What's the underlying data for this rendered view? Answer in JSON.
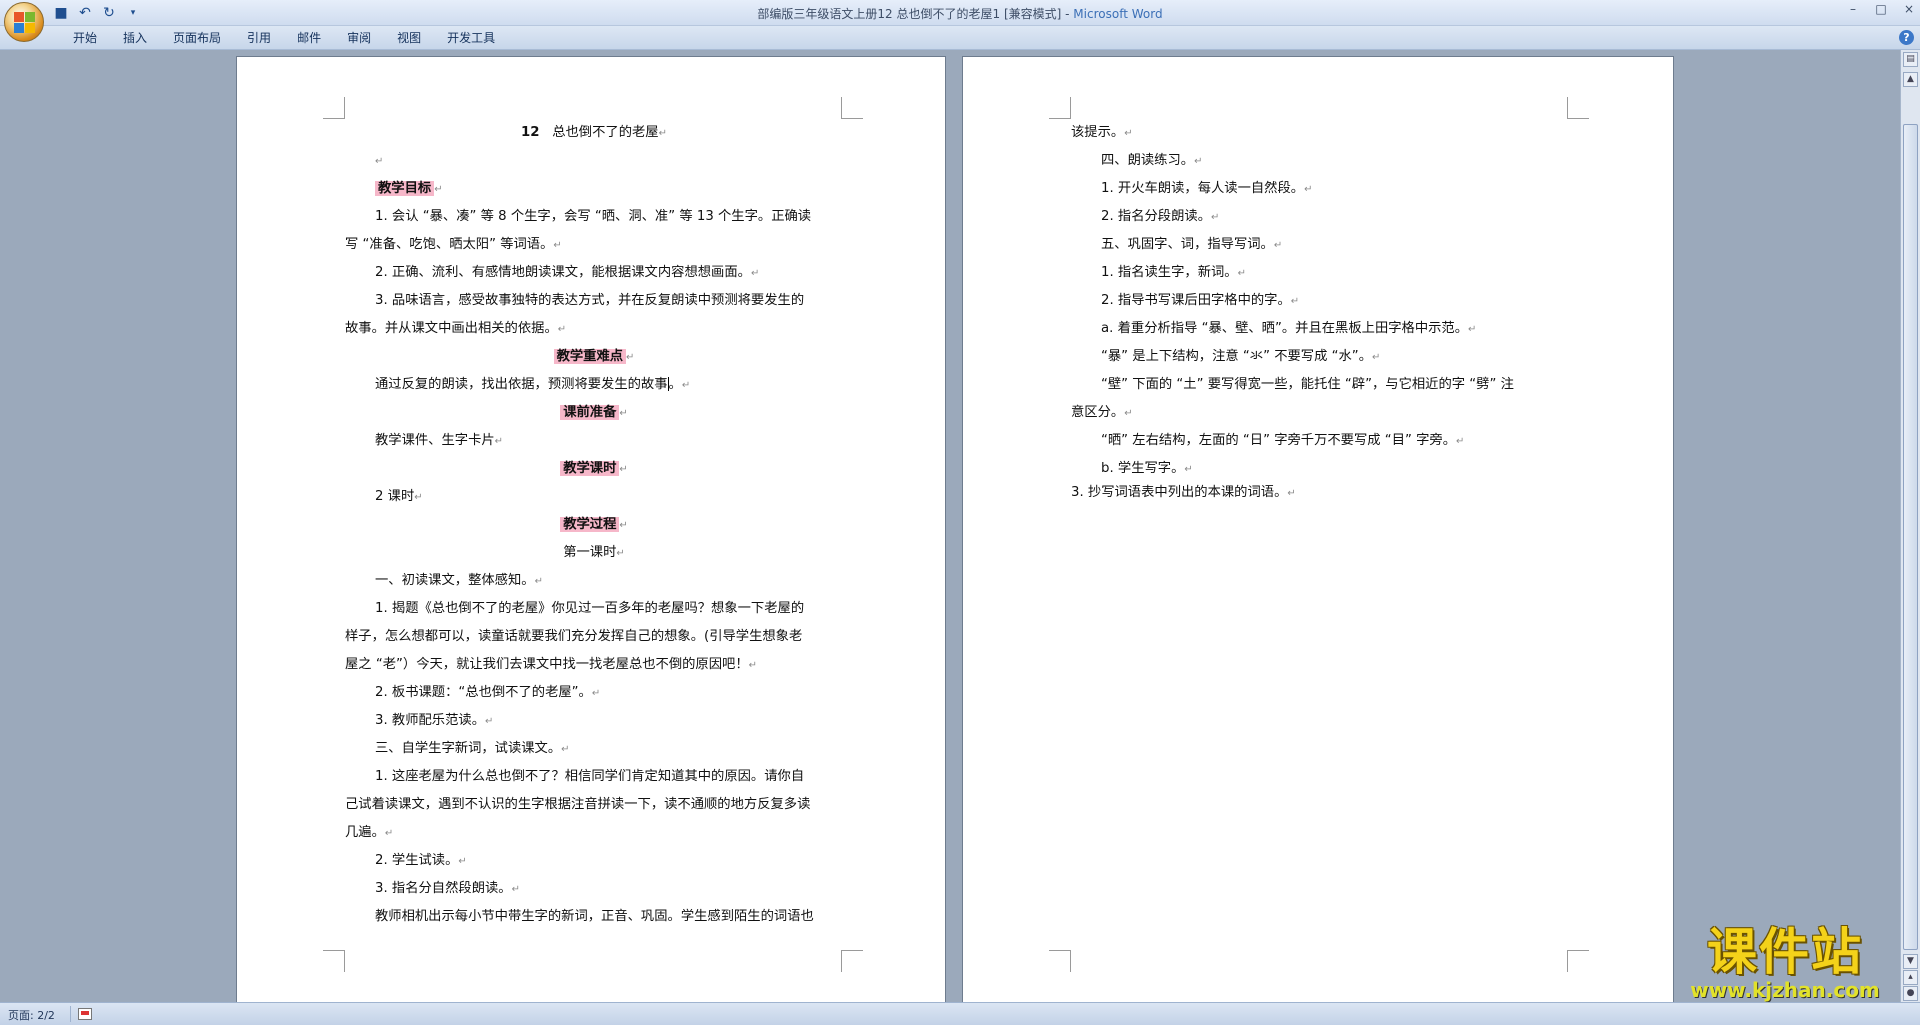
{
  "window": {
    "title": "部编版三年级语文上册12 总也倒不了的老屋1 [兼容模式]",
    "app_name": "Microsoft Word",
    "controls": [
      "–",
      "□",
      "×"
    ]
  },
  "quick_access": [
    "save-icon",
    "undo-icon",
    "redo-icon",
    "customize-icon"
  ],
  "menu": {
    "tabs": [
      "开始",
      "插入",
      "页面布局",
      "引用",
      "邮件",
      "审阅",
      "视图",
      "开发工具"
    ]
  },
  "page1": {
    "title_num": "12",
    "title": "总也倒不了的老屋",
    "h_goal": "教学目标",
    "goal1_a": "1. 会认 “暴、凑” 等 8 个生字，会写 “晒、洞、准” 等 13 个生字。正确读",
    "goal1_b": "写 “准备、吃饱、晒太阳” 等词语。",
    "goal2": "2. 正确、流利、有感情地朗读课文，能根据课文内容想想画面。",
    "goal3_a": "3. 品味语言，感受故事独特的表达方式，并在反复朗读中预测将要发生的",
    "goal3_b": "故事。并从课文中画出相关的依据。",
    "h_key": "教学重难点",
    "key_text": "通过反复的朗读，找出依据，预测将要发生的故事",
    "h_prep": "课前准备",
    "prep_text": "教学课件、生字卡片",
    "h_hours": "教学课时",
    "hours_text": "2 课时",
    "h_process": "教学过程",
    "lesson1": "第一课时",
    "s1": "一、初读课文，整体感知。",
    "s1_1a": "1. 揭题《总也倒不了的老屋》你见过一百多年的老屋吗？想象一下老屋的",
    "s1_1b": "样子，怎么想都可以，读童话就要我们充分发挥自己的想象。(引导学生想象老",
    "s1_1c": "屋之 “老”）今天，就让我们去课文中找一找老屋总也不倒的原因吧！",
    "s1_2": "2. 板书课题：“总也倒不了的老屋”。",
    "s1_3": "3. 教师配乐范读。",
    "s3": "三、自学生字新词，试读课文。",
    "s3_1a": "1. 这座老屋为什么总也倒不了？相信同学们肯定知道其中的原因。请你自",
    "s3_1b": "己试着读课文，遇到不认识的生字根据注音拼读一下，读不通顺的地方反复多读",
    "s3_1c": "几遍。",
    "s3_2": "2. 学生试读。",
    "s3_3": "3. 指名分自然段朗读。",
    "s3_end": "教师相机出示每小节中带生字的新词，正音、巩固。学生感到陌生的词语也"
  },
  "page2": {
    "l1": "该提示。",
    "l2": "四、朗读练习。",
    "l3": "1. 开火车朗读，每人读一自然段。",
    "l4": "2. 指名分段朗读。",
    "l5": "五、巩固字、词，指导写词。",
    "l6": "1. 指名读生字，新词。",
    "l7": "2. 指导书写课后田字格中的字。",
    "l8": "a. 着重分析指导 “暴、壁、晒”。并且在黑板上田字格中示范。",
    "l9": "“暴” 是上下结构，注意 “氺” 不要写成 “水”。",
    "l10a": "“壁” 下面的 “土” 要写得宽一些，能托住 “辟”，与它相近的字 “劈” 注",
    "l10b": "意区分。",
    "l11": "“晒” 左右结构，左面的 “日” 字旁千万不要写成 “目” 字旁。",
    "l12": "b. 学生写字。",
    "l13": "3. 抄写词语表中列出的本课的词语。"
  },
  "status": {
    "page": "页面: 2/2"
  },
  "watermark": {
    "main": "课件站",
    "url": "www.kjzhan.com"
  }
}
